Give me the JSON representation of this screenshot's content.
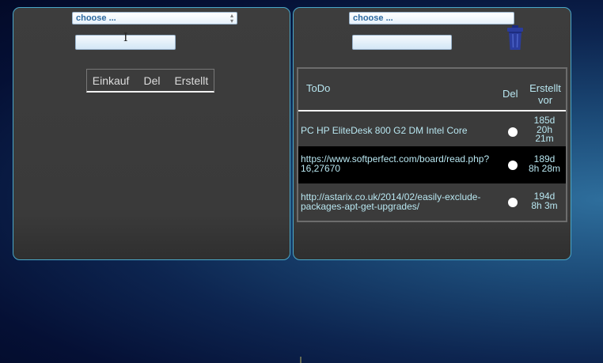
{
  "left_panel": {
    "select": {
      "value": "choose ..."
    },
    "input": {
      "value": ""
    },
    "header": [
      "Einkauf",
      "Del",
      "Erstellt"
    ]
  },
  "right_panel": {
    "select": {
      "value": "choose ..."
    },
    "input": {
      "value": ""
    },
    "table": {
      "columns": {
        "todo": "ToDo",
        "del": "Del",
        "created_line1": "Erstellt",
        "created_line2": "vor"
      },
      "rows": [
        {
          "text": " PC HP EliteDesk 800 G2 DM Intel Core",
          "age": [
            "185d",
            "20h",
            "21m"
          ]
        },
        {
          "text": " https://www.softperfect.com/board/read.php?16,27670",
          "age": [
            "189d",
            "8h 28m"
          ]
        },
        {
          "text": " http://astarix.co.uk/2014/02/easily-exclude-packages-apt-get-upgrades/",
          "age": [
            "194d",
            "8h 3m"
          ]
        }
      ]
    }
  },
  "icons": {
    "trash": "trash-can-icon",
    "cursor": "text-cursor-icon"
  },
  "colors": {
    "panel_border": "#4aa8c8",
    "cell_text": "#b8e6f0",
    "select_text": "#2e6aa0"
  }
}
